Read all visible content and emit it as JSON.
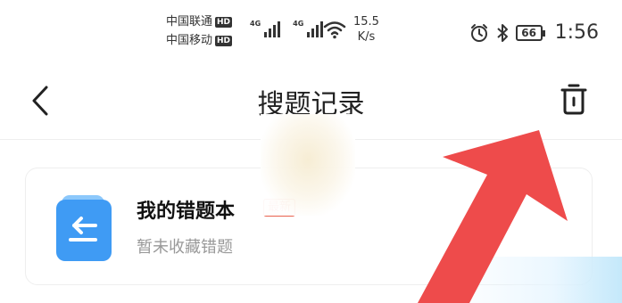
{
  "status_bar": {
    "carrier_1": "中国联通",
    "carrier_2": "中国移动",
    "hd": "HD",
    "network_1": "4G",
    "network_2": "4G",
    "speed_value": "15.5",
    "speed_unit": "K/s",
    "battery": "66",
    "time": "1:56"
  },
  "nav": {
    "title": "搜题记录",
    "back_icon": "chevron-left-icon",
    "trash_icon": "trash-icon"
  },
  "card": {
    "title": "我的错题本",
    "badge": "最新",
    "subtitle": "暂未收藏错题",
    "icon": "notebook-icon",
    "icon_color": "#3f9bf4"
  },
  "annotation": {
    "arrow_color": "#ee4b4b"
  }
}
